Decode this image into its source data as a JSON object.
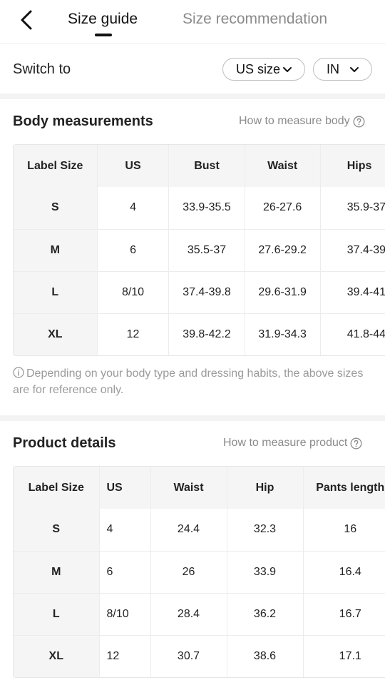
{
  "header": {
    "tabs": [
      {
        "label": "Size guide",
        "active": true
      },
      {
        "label": "Size recommendation",
        "active": false
      }
    ]
  },
  "switch": {
    "label": "Switch to",
    "size_system": "US size",
    "unit": "IN"
  },
  "body_measurements": {
    "title": "Body measurements",
    "link": "How to measure body",
    "columns": [
      "Label Size",
      "US",
      "Bust",
      "Waist",
      "Hips"
    ],
    "rows": [
      [
        "S",
        "4",
        "33.9-35.5",
        "26-27.6",
        "35.9-37"
      ],
      [
        "M",
        "6",
        "35.5-37",
        "27.6-29.2",
        "37.4-39"
      ],
      [
        "L",
        "8/10",
        "37.4-39.8",
        "29.6-31.9",
        "39.4-41"
      ],
      [
        "XL",
        "12",
        "39.8-42.2",
        "31.9-34.3",
        "41.8-44"
      ]
    ],
    "note": "Depending on your body type and dressing habits, the above sizes are for reference only."
  },
  "product_details": {
    "title": "Product details",
    "link": "How to measure product",
    "columns": [
      "Label Size",
      "US",
      "Waist",
      "Hip",
      "Pants length"
    ],
    "rows": [
      [
        "S",
        "4",
        "24.4",
        "32.3",
        "16"
      ],
      [
        "M",
        "6",
        "26",
        "33.9",
        "16.4"
      ],
      [
        "L",
        "8/10",
        "28.4",
        "36.2",
        "16.7"
      ],
      [
        "XL",
        "12",
        "30.7",
        "38.6",
        "17.1"
      ]
    ]
  },
  "colors": {
    "text": "#222222",
    "muted": "#8a8a8a",
    "header_bg": "#f5f5f5",
    "divider": "#f3f3f3"
  }
}
